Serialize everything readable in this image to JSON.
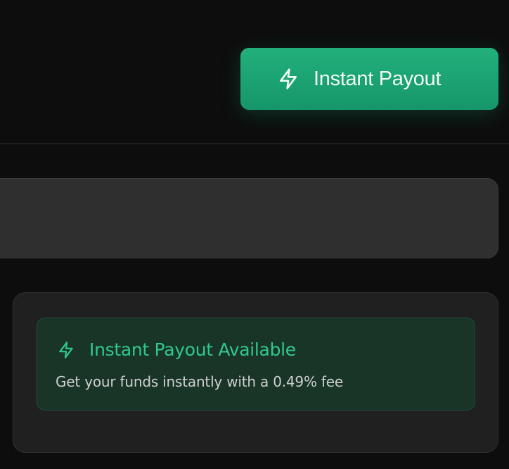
{
  "header": {
    "payout_button": {
      "label": "Instant Payout",
      "icon": "lightning-bolt-icon"
    }
  },
  "notice": {
    "icon": "lightning-bolt-icon",
    "title": "Instant Payout Available",
    "description": "Get your funds instantly with a 0.49% fee"
  },
  "colors": {
    "background": "#0d0d0d",
    "accent_green": "#1fa673",
    "notice_text_green": "#31c98b",
    "panel_gray": "#2f2f2f",
    "card_gray": "#202020",
    "notice_bg": "#193528"
  }
}
